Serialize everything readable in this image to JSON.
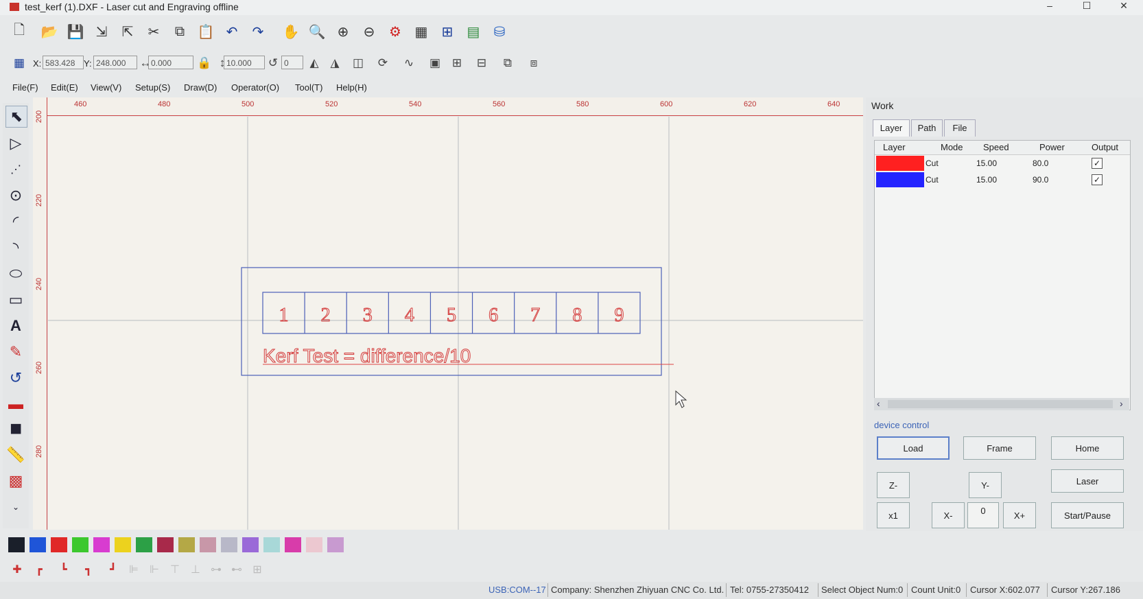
{
  "window": {
    "title": "test_kerf (1).DXF - Laser cut and Engraving offline",
    "minimize": "–",
    "maximize": "☐",
    "close": "✕"
  },
  "toolbar": {
    "icons": [
      "new-icon",
      "open-icon",
      "save-icon",
      "import-icon",
      "export-icon",
      "cut-icon",
      "copy-icon",
      "paste-icon",
      "undo-icon",
      "redo-icon",
      "pan-icon",
      "zoom-window-icon",
      "zoom-in-icon",
      "zoom-out-icon",
      "settings-gear-icon",
      "grid-icon",
      "grid-snap-icon",
      "layer-table-icon",
      "database-icon"
    ]
  },
  "coords": {
    "x_label": "X:",
    "x_value": "583.428",
    "y_label": "Y:",
    "y_value": "248.000",
    "w_value": "0.000",
    "h_value": "10.000",
    "angle_value": "0"
  },
  "menu": [
    "File(F)",
    "Edit(E)",
    "View(V)",
    "Setup(S)",
    "Draw(D)",
    "Operator(O)",
    "Tool(T)",
    "Help(H)"
  ],
  "ruler": {
    "h_ticks": [
      "460",
      "480",
      "500",
      "520",
      "540",
      "560",
      "580",
      "600",
      "620",
      "640"
    ],
    "v_ticks": [
      "200",
      "220",
      "240",
      "260",
      "280"
    ]
  },
  "drawing": {
    "numbers": [
      "1",
      "2",
      "3",
      "4",
      "5",
      "6",
      "7",
      "8",
      "9"
    ],
    "caption": "Kerf Test = difference/10"
  },
  "palette": [
    "#1a1f2a",
    "#1f55d8",
    "#e02828",
    "#3cc82e",
    "#d83cd0",
    "#ecd21e",
    "#2ca046",
    "#a8294a",
    "#b4a846",
    "#c897a8",
    "#b8b8c8",
    "#9a6ad8",
    "#a8d8d8",
    "#d83caa",
    "#ecc8d0",
    "#c89ad0"
  ],
  "work": {
    "title": "Work",
    "tabs": [
      "Layer",
      "Path",
      "File"
    ],
    "headers": [
      "Layer",
      "Mode",
      "Speed",
      "Power",
      "Output"
    ],
    "rows": [
      {
        "color": "#ff2020",
        "mode": "Cut",
        "speed": "15.00",
        "power": "80.0",
        "output": "✓"
      },
      {
        "color": "#2424ff",
        "mode": "Cut",
        "speed": "15.00",
        "power": "90.0",
        "output": "✓"
      }
    ],
    "device_control_label": "device control",
    "buttons": {
      "load": "Load",
      "frame": "Frame",
      "home": "Home",
      "z_minus": "Z-",
      "y_minus": "Y-",
      "laser": "Laser",
      "x1": "x1",
      "x_minus": "X-",
      "step": "0",
      "x_plus": "X+",
      "start_pause": "Start/Pause"
    }
  },
  "status": {
    "port": "USB:COM--17",
    "company": "Company: Shenzhen Zhiyuan CNC Co. Ltd.",
    "tel": "Tel: 0755-27350412",
    "select": "Select Object Num:0",
    "count": "Count Unit:0",
    "cursor_x": "Cursor X:602.077",
    "cursor_y": "Cursor Y:267.186"
  }
}
